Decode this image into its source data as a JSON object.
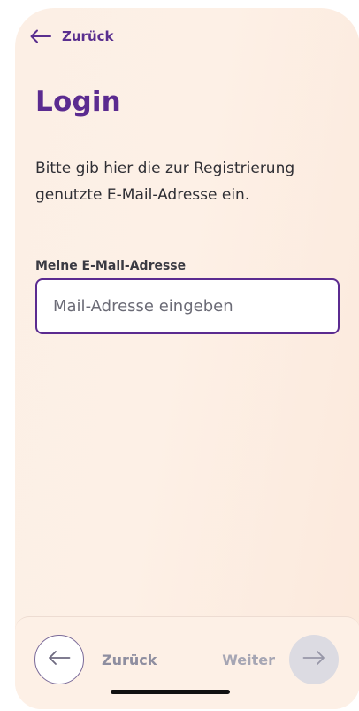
{
  "header": {
    "back_label": "Zurück"
  },
  "main": {
    "title": "Login",
    "intro": "Bitte gib hier die  zur Registrierung genutzte E-Mail-Adresse ein.",
    "email_label": "Meine E-Mail-Adresse",
    "email_placeholder": "Mail-Adresse eingeben",
    "email_value": ""
  },
  "footer": {
    "back_label": "Zurück",
    "next_label": "Weiter"
  },
  "colors": {
    "brand_purple": "#5b2b90",
    "background": "#fdf0e6",
    "disabled_button": "#dcdbe2"
  },
  "icons": {
    "top_back": "arrow-left-icon",
    "footer_back": "arrow-left-icon",
    "footer_next": "arrow-right-icon"
  }
}
